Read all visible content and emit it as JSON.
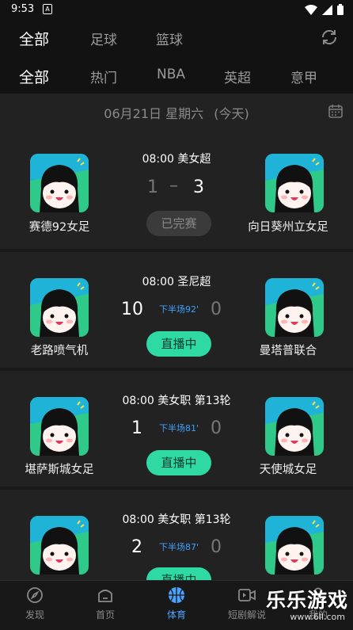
{
  "status_bar": {
    "time": "9:53",
    "sim_icon": "A"
  },
  "top_tabs": [
    {
      "label": "全部",
      "active": true
    },
    {
      "label": "足球",
      "active": false
    },
    {
      "label": "篮球",
      "active": false
    }
  ],
  "sub_tabs": [
    {
      "label": "全部",
      "active": true
    },
    {
      "label": "热门",
      "active": false
    },
    {
      "label": "NBA",
      "active": false
    },
    {
      "label": "英超",
      "active": false
    },
    {
      "label": "意甲",
      "active": false
    }
  ],
  "date_bar": {
    "date": "06月21日 星期六",
    "today": "(今天)"
  },
  "matches": [
    {
      "time_league": "08:00 美女超",
      "home_team": "赛德92女足",
      "away_team": "向日葵州立女足",
      "home_score": "1",
      "separator": "–",
      "away_score": "3",
      "period": "",
      "status": "已完赛",
      "status_type": "done"
    },
    {
      "time_league": "08:00 圣尼超",
      "home_team": "老路喷气机",
      "away_team": "曼塔普联合",
      "home_score": "10",
      "separator": "",
      "away_score": "0",
      "period": "下半场92'",
      "status": "直播中",
      "status_type": "live"
    },
    {
      "time_league": "08:00 美女职 第13轮",
      "home_team": "堪萨斯城女足",
      "away_team": "天使城女足",
      "home_score": "1",
      "separator": "",
      "away_score": "0",
      "period": "下半场81'",
      "status": "直播中",
      "status_type": "live"
    },
    {
      "time_league": "08:00 美女职 第13轮",
      "home_team": "",
      "away_team": "",
      "home_score": "2",
      "separator": "",
      "away_score": "0",
      "period": "下半场87'",
      "status": "直播中",
      "status_type": "live"
    }
  ],
  "bottom_nav": [
    {
      "label": "发现",
      "icon": "compass-icon",
      "active": false
    },
    {
      "label": "首页",
      "icon": "home-icon",
      "active": false
    },
    {
      "label": "体育",
      "icon": "basketball-icon",
      "active": true
    },
    {
      "label": "短剧解说",
      "icon": "video-icon",
      "active": false
    },
    {
      "label": "我的",
      "icon": "user-icon",
      "active": false
    }
  ],
  "watermark": {
    "title": "乐乐游戏",
    "url": "www.6ll.com"
  },
  "colors": {
    "live_green": "#2fd9a3",
    "accent_blue": "#4aa3ff",
    "period_blue": "#3da2ff",
    "background": "#1a1a1a"
  }
}
